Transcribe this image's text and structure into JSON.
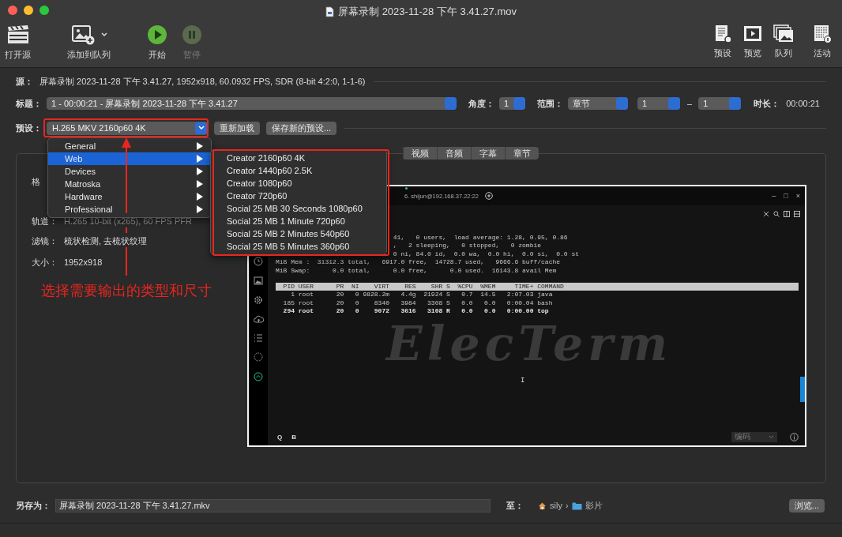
{
  "window": {
    "title": "屏幕录制 2023-11-28 下午 3.41.27.mov"
  },
  "toolbar": {
    "left": [
      {
        "label": "打开源",
        "kind": "open",
        "disabled": false
      },
      {
        "label": "添加到队列",
        "kind": "add",
        "disabled": false
      },
      {
        "label": "开始",
        "kind": "start",
        "disabled": false
      },
      {
        "label": "暂停",
        "kind": "pause",
        "disabled": true
      }
    ],
    "right": [
      {
        "label": "预设",
        "kind": "presets"
      },
      {
        "label": "预览",
        "kind": "preview"
      },
      {
        "label": "队列",
        "kind": "queue"
      },
      {
        "label": "活动",
        "kind": "activity"
      }
    ]
  },
  "source": {
    "label": "源：",
    "value": "屏幕录制 2023-11-28 下午 3.41.27, 1952x918, 60.0932 FPS, SDR (8-bit 4:2:0, 1-1-6)"
  },
  "title_row": {
    "label": "标题：",
    "value": "1 - 00:00:21 - 屏幕录制 2023-11-28 下午 3.41.27",
    "angle_label": "角度：",
    "angle": "1",
    "range_label": "范围：",
    "range_type": "章节",
    "range_from": "1",
    "dash": "–",
    "range_to": "1",
    "duration_label": "时长：",
    "duration": "00:00:21"
  },
  "preset": {
    "label": "预设：",
    "value": "H.265 MKV 2160p60 4K",
    "buttons": [
      "重新加载",
      "保存新的预设..."
    ]
  },
  "preset_menu": [
    {
      "label": "General",
      "selected": false
    },
    {
      "label": "Web",
      "selected": true
    },
    {
      "label": "Devices",
      "selected": false
    },
    {
      "label": "Matroska",
      "selected": false
    },
    {
      "label": "Hardware",
      "selected": false
    },
    {
      "label": "Professional",
      "selected": false
    }
  ],
  "submenu": [
    "Creator 2160p60 4K",
    "Creator 1440p60 2.5K",
    "Creator 1080p60",
    "Creator 720p60",
    "Social 25 MB 30 Seconds 1080p60",
    "Social 25 MB 1 Minute 720p60",
    "Social 25 MB 2 Minutes 540p60",
    "Social 25 MB 5 Minutes 360p60"
  ],
  "tabs": [
    {
      "label": "视频",
      "selected": false
    },
    {
      "label": "音频",
      "selected": false
    },
    {
      "label": "字幕",
      "selected": false
    },
    {
      "label": "章节",
      "selected": false
    }
  ],
  "summary": [
    {
      "label": "格"
    },
    {
      "label": "轨道：",
      "value": "H.265 10-bit (x265), 60 FPS PFR"
    },
    {
      "label": "滤镜：",
      "value": "梳状检测, 去梳状纹理"
    },
    {
      "label": "大小：",
      "value": "1952x918"
    }
  ],
  "annotation": {
    "text": "选择需要输出的类型和尺寸"
  },
  "terminal": {
    "session_tab": "6. shijun@192.168.37.22:22",
    "window_controls": [
      "–",
      "□",
      "×"
    ],
    "lines": [
      {
        "text": "41,   0 users,  load average: 1.28, 0.95, 0.86",
        "kind": "partial"
      },
      {
        "text": ",   2 sleeping,   0 stopped,   0 zombie",
        "kind": "partial"
      },
      {
        "text": "0 ni, 84.0 id,  0.0 wa,  0.0 hi,  0.0 si,  0.0 st",
        "kind": "partial"
      },
      {
        "text": "MiB Mem :  31312.3 total,   6917.0 free,  14728.7 used,   9666.6 buff/cache",
        "kind": "full"
      },
      {
        "text": "MiB Swap:      0.0 total,      0.0 free,      0.0 used.  16143.8 avail Mem",
        "kind": "full"
      }
    ],
    "header": "  PID USER      PR  NI    VIRT    RES    SHR S  %CPU  %MEM     TIME+ COMMAND",
    "processes": [
      {
        "text": "    1 root      20   0 9828.2m   4.4g  21924 S   0.7  14.5   2:07.03 java",
        "bold": false
      },
      {
        "text": "  185 root      20   0    8340   3984   3308 S   0.0   0.0   0:00.04 bash",
        "bold": false
      },
      {
        "text": "  294 root      20   0    9072   3616   3108 R   0.0   0.0   0:00.00 top",
        "bold": true
      }
    ],
    "logo": "ElecTerm",
    "cursor": "I",
    "bottom_buttons": [
      "Q",
      "B"
    ],
    "encoding": "编码"
  },
  "save": {
    "label": "另存为：",
    "value": "屏幕录制 2023-11-28 下午 3.41.27.mkv",
    "to_label": "至：",
    "home": "sily",
    "separator": "›",
    "folder": "影片",
    "browse": "浏览..."
  }
}
